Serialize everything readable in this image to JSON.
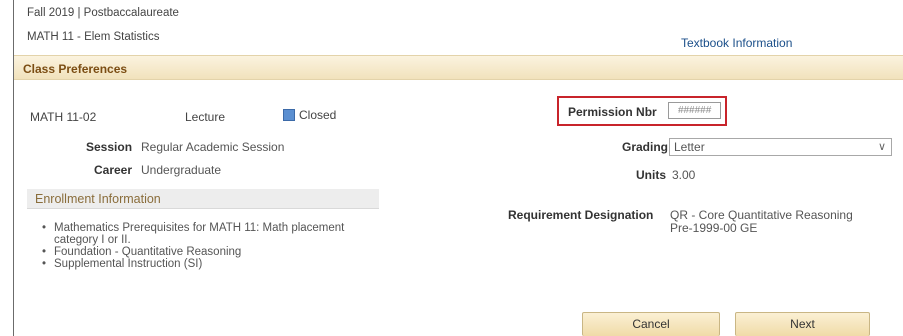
{
  "header": {
    "term": "Fall 2019 | Postbaccalaureate",
    "course": "MATH  11 - Elem Statistics",
    "textbook_link": "Textbook Information"
  },
  "section_title": "Class Preferences",
  "class_info": {
    "section": "MATH  11-02",
    "component": "Lecture",
    "status": "Closed",
    "session_label": "Session",
    "session_value": "Regular Academic Session",
    "career_label": "Career",
    "career_value": "Undergraduate"
  },
  "enrollment": {
    "title": "Enrollment Information",
    "requirements": [
      "Mathematics Prerequisites for MATH 11: Math placement category I or II.",
      "Foundation - Quantitative Reasoning",
      "Supplemental Instruction (SI)"
    ]
  },
  "preferences": {
    "permission_label": "Permission Nbr",
    "permission_placeholder": "######",
    "grading_label": "Grading",
    "grading_value": "Letter",
    "units_label": "Units",
    "units_value": "3.00",
    "requirement_label": "Requirement Designation",
    "requirement_line1": "QR - Core Quantitative Reasoning",
    "requirement_line2": "Pre-1999-00 GE"
  },
  "buttons": {
    "cancel": "Cancel",
    "next": "Next"
  },
  "colors": {
    "header_accent": "#7b4d13",
    "link": "#1b4f8a",
    "highlight_border": "#c8242b",
    "status_icon": "#5b8fd1"
  }
}
